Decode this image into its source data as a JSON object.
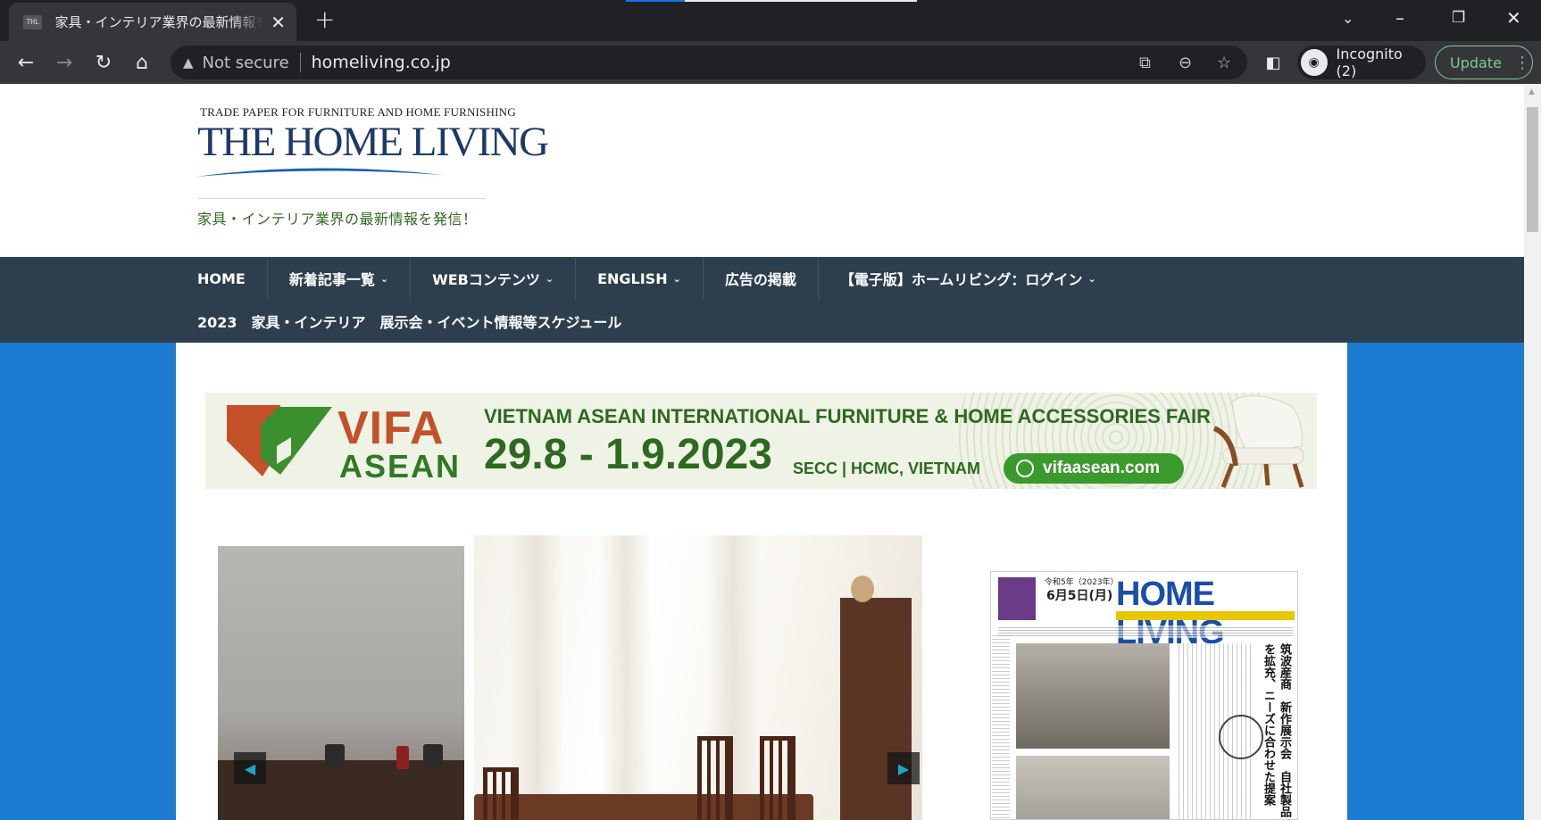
{
  "browser": {
    "tab_title": "家具・インテリア業界の最新情報を発信！",
    "favicon_text": "THL",
    "new_tab": "+",
    "not_secure": "Not secure",
    "url": "homeliving.co.jp",
    "incognito_label": "Incognito (2)",
    "update_label": "Update"
  },
  "site": {
    "logo_tagline": "TRADE PAPER FOR FURNITURE AND HOME FURNISHING",
    "logo_title": "THE HOME LIVING",
    "slogan": "家具・インテリア業界の最新情報を発信！"
  },
  "nav": {
    "row1": [
      {
        "label": "HOME",
        "dropdown": false
      },
      {
        "label": "新着記事一覧",
        "dropdown": true
      },
      {
        "label": "WEBコンテンツ",
        "dropdown": true
      },
      {
        "label": "ENGLISH",
        "dropdown": true
      },
      {
        "label": "広告の掲載",
        "dropdown": false
      },
      {
        "label": "【電子版】ホームリビング：ログイン",
        "dropdown": true
      }
    ],
    "row2": [
      {
        "label": "2023　家具・インテリア　展示会・イベント情報等スケジュール"
      }
    ]
  },
  "banner": {
    "brand_top": "VIFA",
    "brand_bottom": "ASEAN",
    "headline": "VIETNAM ASEAN INTERNATIONAL FURNITURE & HOME ACCESSORIES FAIR",
    "dates": "29.8 - 1.9.2023",
    "venue": "SECC | HCMC, VIETNAM",
    "site": "vifaasean.com"
  },
  "newspaper": {
    "era_date": "令和5年（2023年）",
    "date": "6月5日(月)",
    "title": "HOME LIVING",
    "headline": "筑波産商　新作展示会　自社製品を拡充、ニーズに合わせた提案"
  },
  "colors": {
    "page_bg": "#1c7cd1",
    "nav_bg": "#2d3e4e",
    "logo_blue": "#1b3a6b",
    "slogan_green": "#2e6b1f",
    "slider_arrow": "#18a7c9"
  }
}
